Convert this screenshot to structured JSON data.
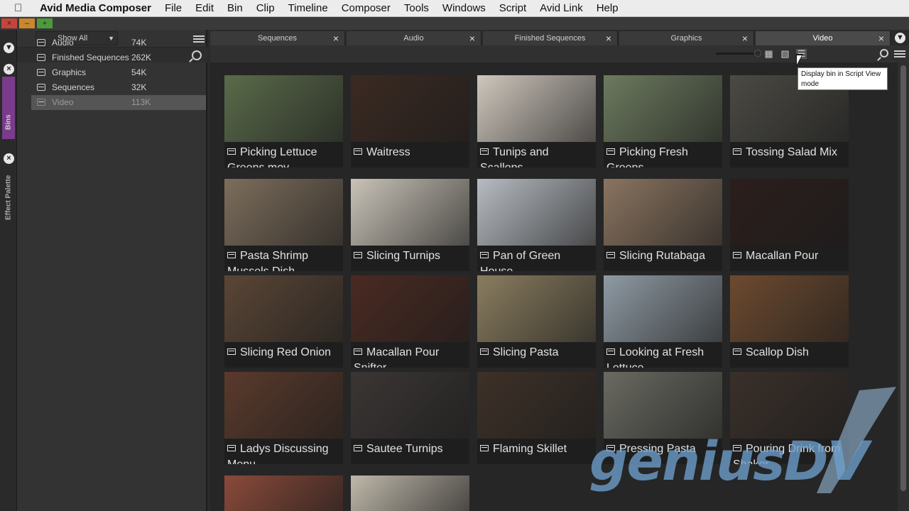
{
  "menubar": {
    "app_name": "Avid Media Composer",
    "items": [
      "File",
      "Edit",
      "Bin",
      "Clip",
      "Timeline",
      "Composer",
      "Tools",
      "Windows",
      "Script",
      "Avid Link",
      "Help"
    ]
  },
  "left_strip": {
    "bins_tab": "Bins",
    "effect_palette_tab": "Effect Palette"
  },
  "bin_panel": {
    "filter_value": "Show All",
    "bins": [
      {
        "name": "Audio",
        "size": "74K",
        "selected": false
      },
      {
        "name": "Finished Sequences",
        "size": "262K",
        "selected": false
      },
      {
        "name": "Graphics",
        "size": "54K",
        "selected": false
      },
      {
        "name": "Sequences",
        "size": "32K",
        "selected": false
      },
      {
        "name": "Video",
        "size": "113K",
        "selected": true
      }
    ]
  },
  "tabs": [
    {
      "label": "Sequences",
      "active": false
    },
    {
      "label": "Audio",
      "active": false
    },
    {
      "label": "Finished Sequences",
      "active": false
    },
    {
      "label": "Graphics",
      "active": false
    },
    {
      "label": "Video",
      "active": true
    }
  ],
  "tooltip": "Display bin in Script View mode",
  "clips": [
    {
      "title": "Picking Lettuce Greens.mov"
    },
    {
      "title": "Waitress"
    },
    {
      "title": "Tunips and Scallops"
    },
    {
      "title": "Picking Fresh Greens"
    },
    {
      "title": "Tossing Salad Mix"
    },
    {
      "title": "Pasta Shrimp Mussels Dish"
    },
    {
      "title": "Slicing Turnips"
    },
    {
      "title": "Pan of Green House"
    },
    {
      "title": "Slicing Rutabaga"
    },
    {
      "title": "Macallan Pour"
    },
    {
      "title": "Slicing Red Onion"
    },
    {
      "title": "Macallan Pour Snifter"
    },
    {
      "title": "Slicing Pasta"
    },
    {
      "title": "Looking at Fresh Lettuce"
    },
    {
      "title": "Scallop Dish"
    },
    {
      "title": "Ladys Discussing Menu"
    },
    {
      "title": "Sautee Turnips"
    },
    {
      "title": "Flaming Skillet"
    },
    {
      "title": "Pressing Pasta"
    },
    {
      "title": "Pouring Drink from Shaker"
    }
  ],
  "thumbnail_colors": [
    "#5a6b4a",
    "#3b2a22",
    "#cfc7bd",
    "#6c7a5e",
    "#4b4a44",
    "#7d6e5c",
    "#c9c3b8",
    "#b7bcc2",
    "#8a7460",
    "#2b1f1c",
    "#5a4636",
    "#4a2a22",
    "#8a7d5f",
    "#8f9aa3",
    "#6d4a2f",
    "#5a3a2c",
    "#3a3634",
    "#3d3128",
    "#6a6a62",
    "#3a302a",
    "#8a4a3a",
    "#bfb8aa"
  ],
  "watermark": "geniusDV"
}
